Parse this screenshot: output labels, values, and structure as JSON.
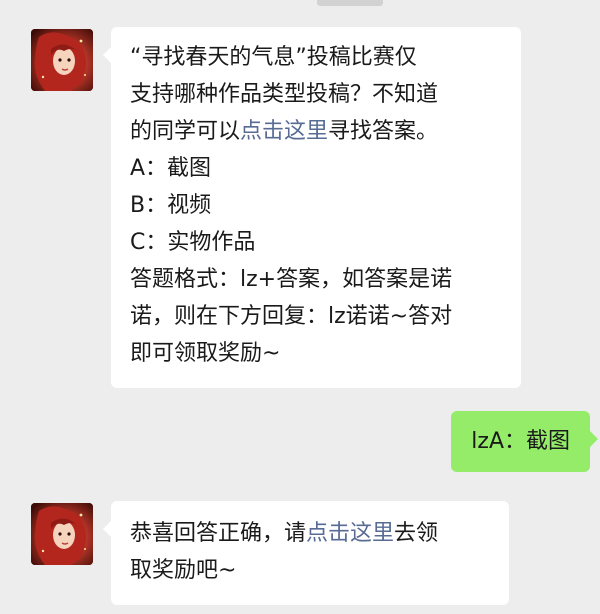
{
  "chat": {
    "messages": [
      {
        "lines": [
          {
            "parts": [
              "“寻找春天的气息”投稿比赛仅"
            ]
          },
          {
            "parts": [
              "支持哪种作品类型投稿？不知道"
            ]
          },
          {
            "parts": [
              "的同学可以",
              "点击这里",
              "寻找答案。"
            ]
          },
          {
            "parts": [
              "A：截图"
            ]
          },
          {
            "parts": [
              "B：视频"
            ]
          },
          {
            "parts": [
              "C：实物作品"
            ]
          },
          {
            "parts": [
              "答题格式：lz+答案，如答案是诺"
            ]
          },
          {
            "parts": [
              "诺，则在下方回复：lz诺诺~答对"
            ]
          },
          {
            "parts": [
              "即可领取奖励~"
            ]
          }
        ]
      },
      {
        "text": "lzA：截图"
      },
      {
        "lines": [
          {
            "parts": [
              "恭喜回答正确，请",
              "点击这里",
              "去领"
            ]
          },
          {
            "parts": [
              "取奖励吧~"
            ]
          }
        ]
      }
    ]
  },
  "colors": {
    "background": "#ededed",
    "bubble_incoming": "#ffffff",
    "bubble_outgoing": "#95ec69",
    "link": "#576b95",
    "text": "#1a1a1a"
  },
  "icons": {
    "avatar": "avatar-icon"
  }
}
